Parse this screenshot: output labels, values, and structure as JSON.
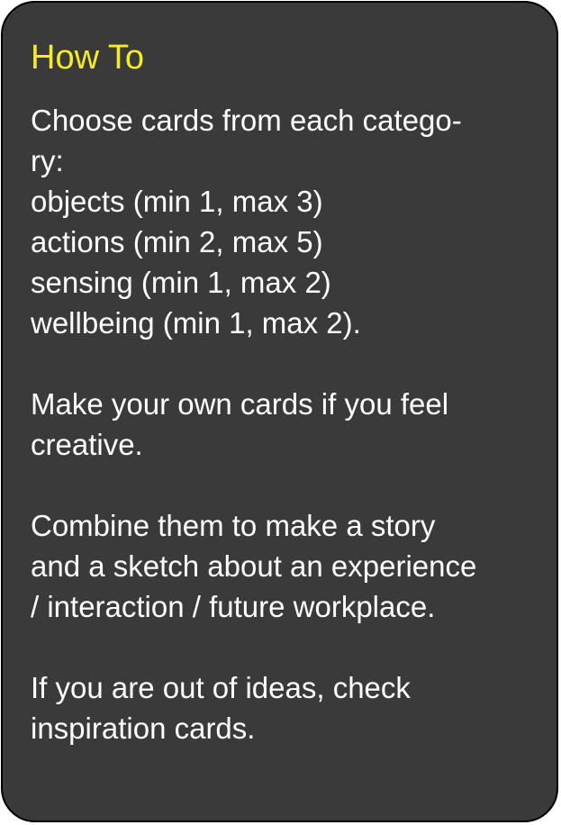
{
  "card": {
    "title": "How To",
    "lines": [
      "Choose cards from each catego-",
      "ry:",
      "objects (min 1, max 3)",
      "actions (min 2, max 5)",
      "sensing (min 1, max 2)",
      "wellbeing (min 1, max 2).",
      "",
      "Make your own cards if you feel",
      "creative.",
      "",
      "Combine them to make a story",
      "and a sketch about an experience",
      "/ interaction / future workplace.",
      "",
      "If you are out of ideas, check",
      "inspiration cards."
    ]
  },
  "colors": {
    "background": "#3a3a3b",
    "title": "#f7ec22",
    "text": "#ffffff",
    "border": "#000000"
  }
}
